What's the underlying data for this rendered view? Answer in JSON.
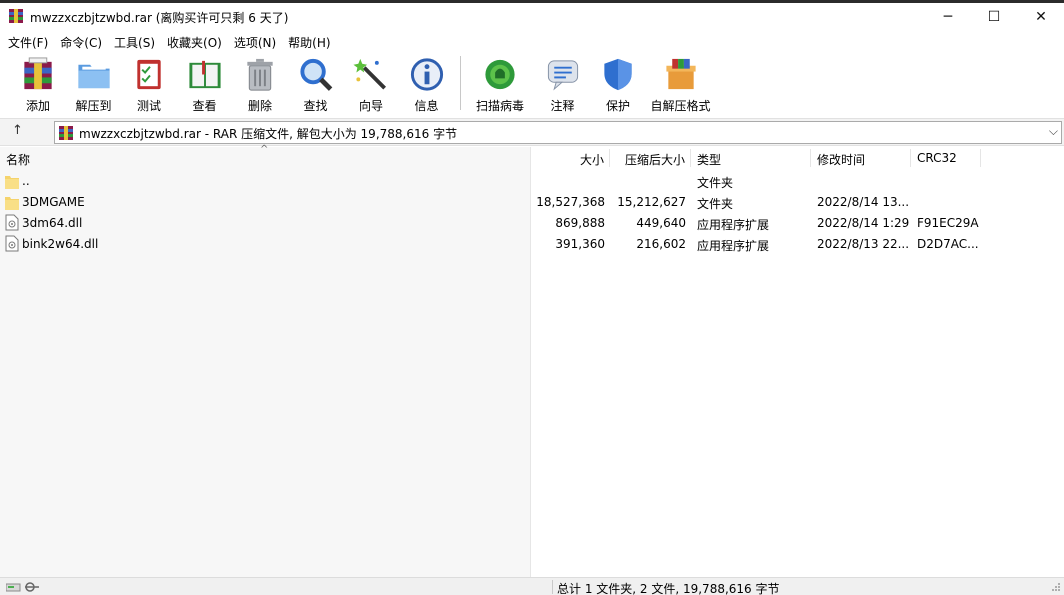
{
  "window": {
    "title": "mwzzxczbjtzwbd.rar (离购买许可只剩 6 天了)",
    "minimize_glyph": "─",
    "maximize_glyph": "☐",
    "close_glyph": "✕"
  },
  "menu": [
    "文件(F)",
    "命令(C)",
    "工具(S)",
    "收藏夹(O)",
    "选项(N)",
    "帮助(H)"
  ],
  "toolbar": [
    {
      "label": "添加",
      "icon": "add-archive-icon"
    },
    {
      "label": "解压到",
      "icon": "extract-folder-icon"
    },
    {
      "label": "测试",
      "icon": "test-checklist-icon"
    },
    {
      "label": "查看",
      "icon": "view-book-icon"
    },
    {
      "label": "删除",
      "icon": "trash-icon"
    },
    {
      "label": "查找",
      "icon": "magnifier-icon"
    },
    {
      "label": "向导",
      "icon": "wizard-wand-icon"
    },
    {
      "label": "信息",
      "icon": "info-icon"
    },
    {
      "label": "扫描病毒",
      "icon": "virus-scan-icon"
    },
    {
      "label": "注释",
      "icon": "comment-icon"
    },
    {
      "label": "保护",
      "icon": "shield-icon"
    },
    {
      "label": "自解压格式",
      "icon": "sfx-box-icon"
    }
  ],
  "address": {
    "up_glyph": "↑",
    "path": "mwzzxczbjtzwbd.rar - RAR 压缩文件, 解包大小为 19,788,616 字节",
    "dropdown_glyph": "⌵"
  },
  "columns": {
    "name": "名称",
    "size": "大小",
    "packed": "压缩后大小",
    "type": "类型",
    "modified": "修改时间",
    "crc": "CRC32",
    "sort_glyph": "^"
  },
  "files": [
    {
      "name": "..",
      "size": "",
      "packed": "",
      "type": "文件夹",
      "modified": "",
      "crc": "",
      "kind": "folder"
    },
    {
      "name": "3DMGAME",
      "size": "18,527,368",
      "packed": "15,212,627",
      "type": "文件夹",
      "modified": "2022/8/14 13...",
      "crc": "",
      "kind": "folder"
    },
    {
      "name": "3dm64.dll",
      "size": "869,888",
      "packed": "449,640",
      "type": "应用程序扩展",
      "modified": "2022/8/14 1:29",
      "crc": "F91EC29A",
      "kind": "dll"
    },
    {
      "name": "bink2w64.dll",
      "size": "391,360",
      "packed": "216,602",
      "type": "应用程序扩展",
      "modified": "2022/8/13 22...",
      "crc": "D2D7AC...",
      "kind": "dll"
    }
  ],
  "status": {
    "text": "总计 1 文件夹, 2 文件, 19,788,616 字节"
  },
  "colors": {
    "folder": "#f5d36b",
    "selection_pane": "#f7f7f7",
    "accent_blue": "#2f6fcf"
  }
}
